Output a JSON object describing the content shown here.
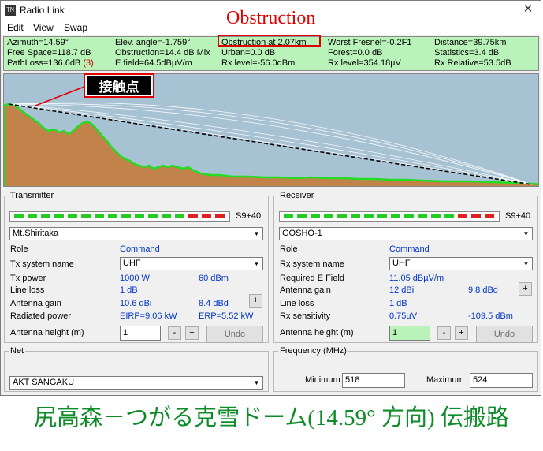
{
  "window": {
    "title": "Radio Link",
    "app_icon": "radio-link-app-icon",
    "close_glyph": "✕"
  },
  "annotation_title": "Obstruction",
  "callout": "接触点",
  "menu": [
    "Edit",
    "View",
    "Swap"
  ],
  "info": {
    "azimuth": "Azimuth=14.59°",
    "elev_angle": "Elev. angle=-1.759°",
    "obstruction_at": "Obstruction at 2.07km",
    "worst_fresnel": "Worst Fresnel=-0.2F1",
    "distance": "Distance=39.75km",
    "free_space": "Free Space=118.7 dB",
    "obstruction_db": "Obstruction=14.4 dB Mix",
    "urban": "Urban=0.0 dB",
    "forest": "Forest=0.0 dB",
    "statistics": "Statistics=3.4 dB",
    "pathloss": "PathLoss=136.6dB",
    "pathloss_flag": "(3)",
    "e_field": "E field=64.5dBµV/m",
    "rx_level_dbm": "Rx level=-56.0dBm",
    "rx_level_uv": "Rx level=354.18µV",
    "rx_relative": "Rx Relative=53.5dB"
  },
  "transmitter": {
    "legend": "Transmitter",
    "signal": "S9+40",
    "site": "Mt.Shiritaka",
    "role_label": "Role",
    "role_value": "Command",
    "system_label": "Tx system name",
    "system_value": "UHF",
    "power_label": "Tx power",
    "power_w": "1000 W",
    "power_dbm": "60 dBm",
    "loss_label": "Line loss",
    "loss_value": "1 dB",
    "gain_label": "Antenna gain",
    "gain_dbi": "10.6 dBi",
    "gain_dbd": "8.4 dBd",
    "radiated_label": "Radiated power",
    "eirp": "EIRP=9.06 kW",
    "erp": "ERP=5.52 kW",
    "height_label": "Antenna height (m)",
    "height_value": "1",
    "minus": "-",
    "plus": "+",
    "undo": "Undo"
  },
  "receiver": {
    "legend": "Receiver",
    "signal": "S9+40",
    "site": "GOSHO-1",
    "role_label": "Role",
    "role_value": "Command",
    "system_label": "Rx system name",
    "system_value": "UHF",
    "field_label": "Required E Field",
    "field_value": "11.05 dBµV/m",
    "gain_label": "Antenna gain",
    "gain_dbi": "12 dBi",
    "gain_dbd": "9.8 dBd",
    "loss_label": "Line loss",
    "loss_value": "1 dB",
    "sens_label": "Rx sensitivity",
    "sens_uv": "0.75µV",
    "sens_dbm": "-109.5 dBm",
    "height_label": "Antenna height (m)",
    "height_value": "1",
    "minus": "-",
    "plus": "+",
    "undo": "Undo"
  },
  "net": {
    "legend": "Net",
    "value": "AKT SANGAKU"
  },
  "frequency": {
    "legend": "Frequency (MHz)",
    "min_label": "Minimum",
    "min_value": "518",
    "max_label": "Maximum",
    "max_value": "524"
  },
  "meter": {
    "segments": 16,
    "red_from": 13,
    "green": "#22cc22",
    "red": "#e02020"
  },
  "colors": {
    "terrain": "#c2834a",
    "terrain_edge": "#22dd22",
    "sky": "#a7c2d3",
    "info_bg": "#b9f3b9",
    "accent_red": "#e00000",
    "caption": "#0f8c2a"
  },
  "caption": "尻高森－つがる克雪ドーム(14.59° 方向) 伝搬路"
}
